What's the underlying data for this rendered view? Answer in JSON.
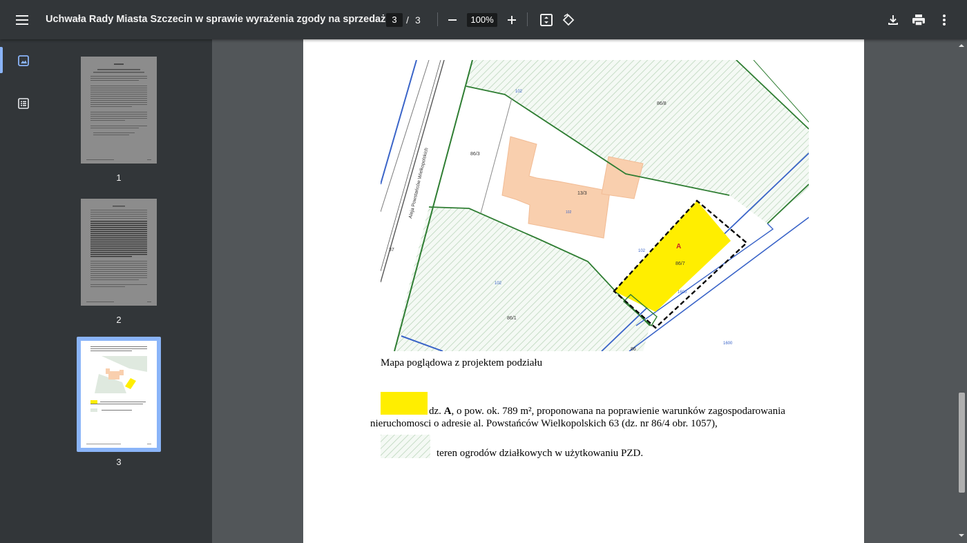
{
  "toolbar": {
    "title": "Uchwała Rady Miasta Szczecin w sprawie wyrażenia zgody na sprzedaż ...",
    "current_page": "3",
    "page_separator": "/",
    "total_pages": "3",
    "zoom": "100%",
    "icons": [
      "menu-icon",
      "zoom-out-icon",
      "zoom-in-icon",
      "fit-page-icon",
      "rotate-icon",
      "download-icon",
      "print-icon",
      "more-options-icon"
    ]
  },
  "sidebar": {
    "tabs": [
      "thumbnails-icon",
      "outline-icon"
    ],
    "thumbnails": [
      {
        "label": "1"
      },
      {
        "label": "2"
      },
      {
        "label": "3"
      }
    ]
  },
  "page": {
    "map_labels": {
      "street": "Aleja Powstańców Wielkopolskich",
      "parcel_86_3": "86/3",
      "parcel_13_3": "13/3",
      "parcel_86_7": "86/7",
      "parcel_86_1": "86/1",
      "parcel_86_8": "86/8",
      "area_a": "A",
      "edge_37": "37",
      "edge_86": "86",
      "road_1": "102",
      "road_2": "102",
      "road_3": "102",
      "road_4": "102",
      "road_5": "1600",
      "road_6": "1600"
    },
    "caption": "Mapa poglądowa z projektem podziału",
    "legend": {
      "item1_prefix": "dz. ",
      "item1_bold": "A",
      "item1_line1": ", o pow. ok. 789 m², proponowana na poprawienie warunków zagospodarowania",
      "item1_line2": "nieruchomosci o adresie al. Powstańców Wielkopolskich 63  (dz. nr 86/4 obr. 1057),",
      "item2": "teren ogrodów działkowych w użytkowaniu PZD."
    },
    "colors": {
      "parcel_a": "#ffee00",
      "building": "#f9cfae",
      "garden_hatch": "#cfe3cf",
      "boundary_green": "#2e7d32",
      "road_blue": "#3a64c8"
    }
  }
}
